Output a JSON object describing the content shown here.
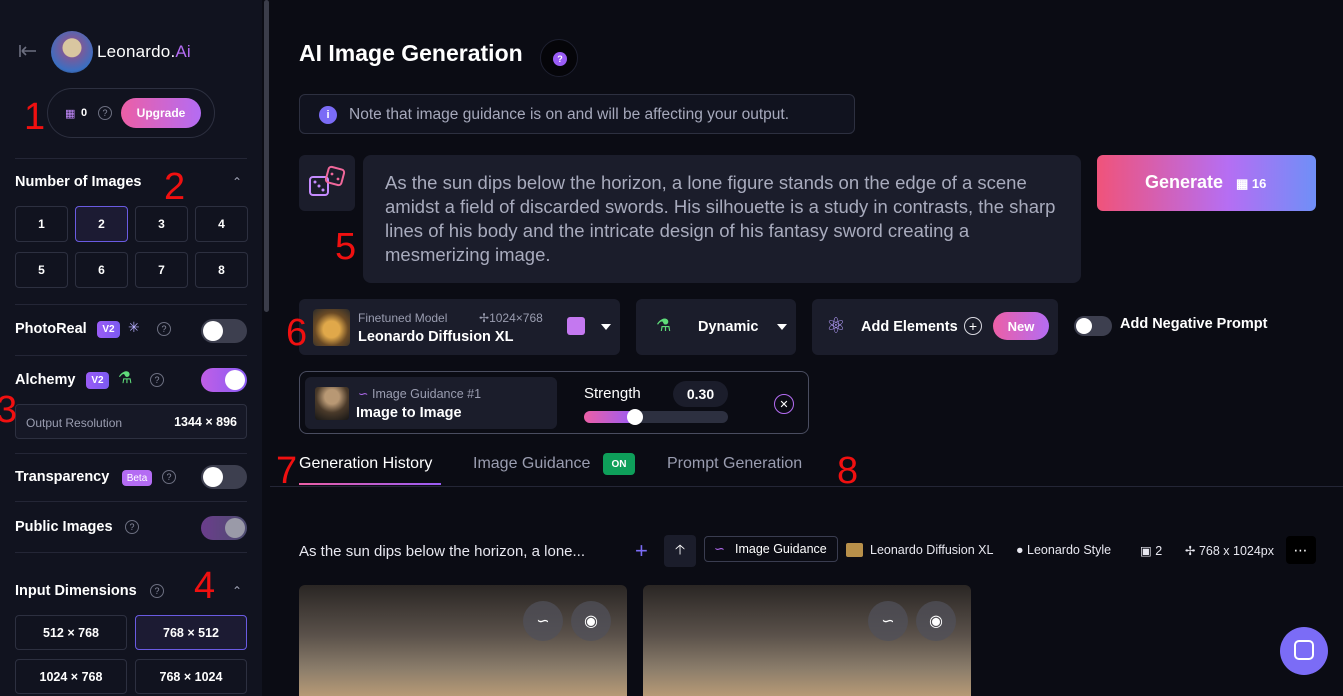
{
  "sidebar": {
    "logo": {
      "name": "Leonardo.",
      "suffix": "Ai"
    },
    "tokens": {
      "count": "0",
      "upgrade_label": "Upgrade"
    },
    "number_of_images": {
      "title": "Number of Images",
      "options": [
        "1",
        "2",
        "3",
        "4",
        "5",
        "6",
        "7",
        "8"
      ],
      "selected": "2"
    },
    "photoreal": {
      "label": "PhotoReal",
      "badge": "V2",
      "enabled": false
    },
    "alchemy": {
      "label": "Alchemy",
      "badge": "V2",
      "enabled": true
    },
    "output_resolution": {
      "label": "Output Resolution",
      "value": "1344 × 896"
    },
    "transparency": {
      "label": "Transparency",
      "badge": "Beta",
      "enabled": false
    },
    "public_images": {
      "label": "Public Images",
      "enabled": true
    },
    "input_dimensions": {
      "title": "Input Dimensions",
      "options": [
        "512 × 768",
        "768 × 512",
        "1024 × 768",
        "768 × 1024"
      ],
      "selected": "768 × 512"
    }
  },
  "annotations": [
    "1",
    "2",
    "3",
    "4",
    "5",
    "6",
    "7",
    "8"
  ],
  "main": {
    "title": "AI Image Generation",
    "note": "Note that image guidance is on and will be affecting your output.",
    "prompt": "As the sun dips below the horizon, a lone figure stands on the edge of a scene amidst a field of discarded swords. His silhouette is a study in contrasts, the sharp lines of his body and the intricate design of his fantasy sword creating a mesmerizing image.",
    "generate": {
      "label": "Generate",
      "cost": "16"
    },
    "model": {
      "caption": "Finetuned Model",
      "dimensions": "1024×768",
      "name": "Leonardo Diffusion XL"
    },
    "style": {
      "label": "Dynamic"
    },
    "elements": {
      "label": "Add Elements",
      "badge": "New"
    },
    "negative_prompt": {
      "label": "Add Negative Prompt",
      "enabled": false
    },
    "image_guidance": {
      "caption": "Image Guidance #1",
      "name": "Image to Image",
      "strength_label": "Strength",
      "strength_value": "0.30",
      "strength": 0.3
    },
    "tabs": [
      {
        "label": "Generation History",
        "active": true
      },
      {
        "label": "Image Guidance",
        "badge": "ON"
      },
      {
        "label": "Prompt Generation"
      }
    ],
    "history": {
      "prompt": "As the sun dips below the horizon, a lone...",
      "guidance_tag": "Image Guidance",
      "model": "Leonardo Diffusion XL",
      "style": "Leonardo Style",
      "count": "2",
      "size": "768 x 1024px"
    }
  },
  "colors": {
    "accent": "#9a5cf6",
    "brand_pink": "#ec5fa6",
    "annotation": "#f01010"
  }
}
